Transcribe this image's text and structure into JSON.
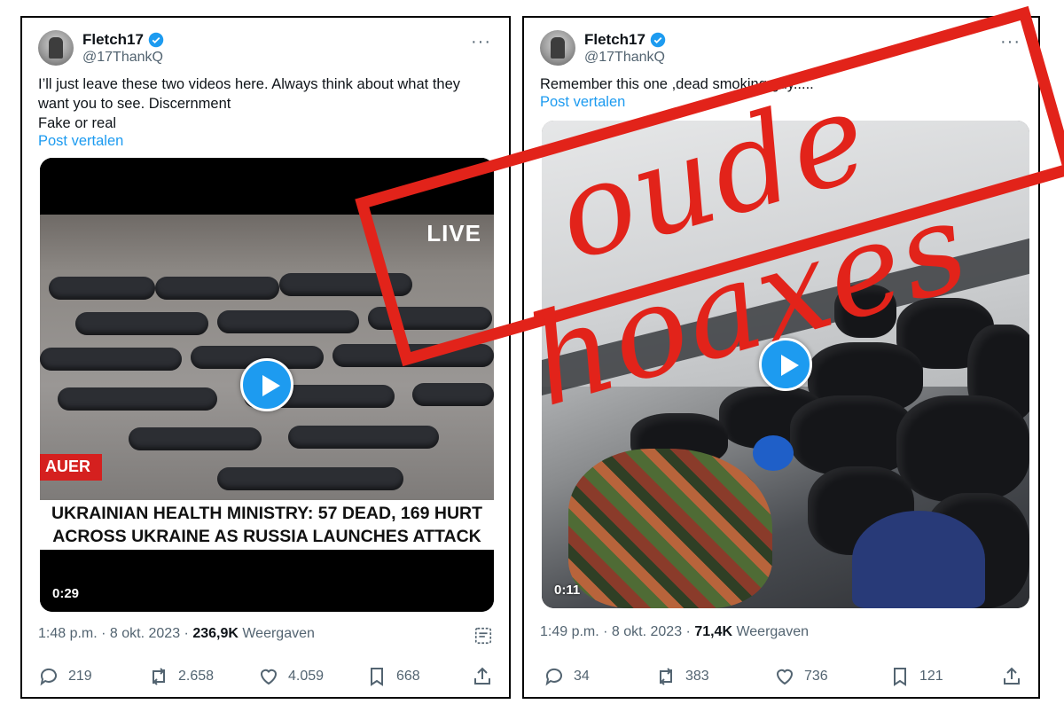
{
  "left_post": {
    "name": "Fletch17",
    "handle": "@17ThankQ",
    "more_label": "···",
    "text_line1": "I’ll just leave these two videos here. Always think about what they",
    "text_line2": "want you to see. Discernment",
    "text_line3": "Fake or real",
    "translate": "Post vertalen",
    "video": {
      "live_badge": "LIVE",
      "channel_tag": "AUER",
      "caption_line1": "UKRAINIAN HEALTH MINISTRY: 57 DEAD, 169 HURT",
      "caption_line2": "ACROSS UKRAINE AS RUSSIA LAUNCHES ATTACK",
      "duration": "0:29"
    },
    "time": "1:48 p.m. · 8 okt. 2023 · ",
    "views": "236,9K",
    "views_label": " Weergaven",
    "replies": "219",
    "reposts": "2.658",
    "likes": "4.059",
    "bookmarks": "668"
  },
  "right_post": {
    "name": "Fletch17",
    "handle": "@17ThankQ",
    "more_label": "···",
    "text_line1": "Remember this one ,dead smoking guy.....",
    "translate": "Post vertalen",
    "video": {
      "duration": "0:11"
    },
    "time": "1:49 p.m. · 8 okt. 2023 · ",
    "views": "71,4K",
    "views_label": " Weergaven",
    "replies": "34",
    "reposts": "383",
    "likes": "736",
    "bookmarks": "121"
  },
  "stamp": {
    "text": "oude hoaxes",
    "color": "#e2231a"
  },
  "colors": {
    "link": "#1d9bf0",
    "muted": "#536471",
    "text": "#0f1419"
  }
}
